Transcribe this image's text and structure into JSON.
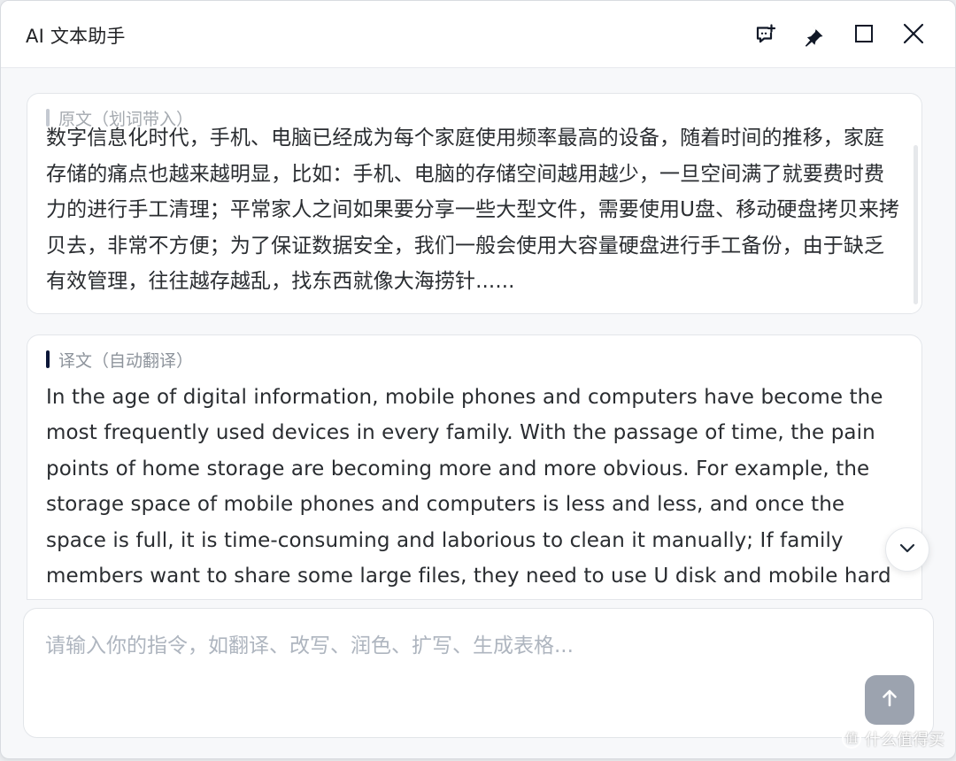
{
  "window": {
    "title": "AI 文本助手"
  },
  "icons": {
    "new_chat": "new-chat-icon",
    "pin": "pin-icon",
    "maximize": "maximize-icon",
    "close": "close-icon",
    "scroll_down": "chevron-down-icon",
    "send": "arrow-up-icon"
  },
  "source": {
    "label": "原文（划词带入）",
    "text": "数字信息化时代，手机、电脑已经成为每个家庭使用频率最高的设备，随着时间的推移，家庭存储的痛点也越来越明显，比如：手机、电脑的存储空间越用越少，一旦空间满了就要费时费力的进行手工清理；平常家人之间如果要分享一些大型文件，需要使用U盘、移动硬盘拷贝来拷贝去，非常不方便；为了保证数据安全，我们一般会使用大容量硬盘进行手工备份，由于缺乏有效管理，往往越存越乱，找东西就像大海捞针......"
  },
  "translation": {
    "label": "译文（自动翻译）",
    "text": "In the age of digital information, mobile phones and computers have become the most frequently used devices in every family. With the passage of time, the pain points of home storage are becoming more and more obvious. For example, the storage space of mobile phones and computers is less and less, and once the space is full, it is time-consuming and laborious to clean it manually; If family members want to share some large files, they need to use U disk and mobile hard disk copies"
  },
  "input": {
    "placeholder": "请输入你的指令，如翻译、改写、润色、扩写、生成表格..."
  },
  "watermark": {
    "text": "什么值得买"
  },
  "colors": {
    "accent": "#0b1638",
    "muted_text": "#8e949c",
    "send_button": "#9ca3af",
    "card_border": "#e3e6ea"
  }
}
